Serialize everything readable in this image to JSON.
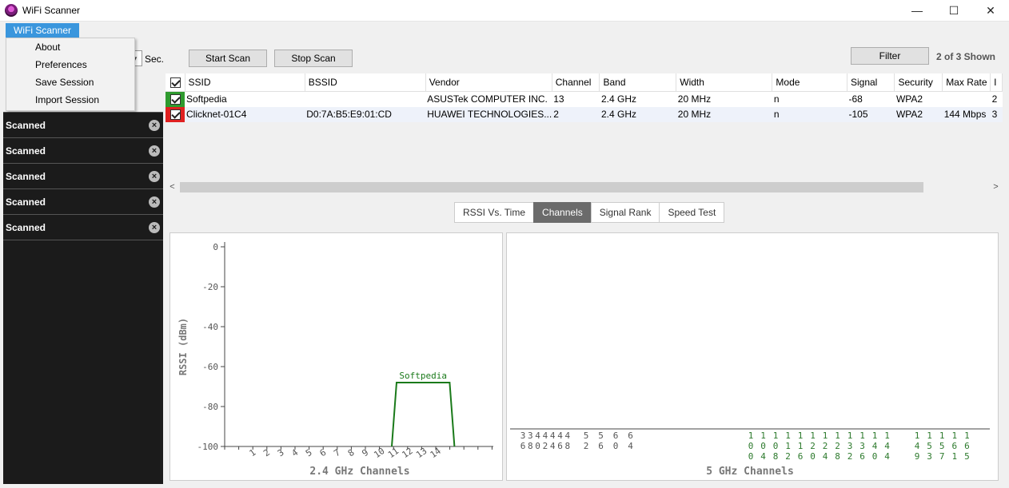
{
  "window": {
    "title": "WiFi Scanner",
    "minimize": "—",
    "maximize": "☐",
    "close": "✕"
  },
  "menu": {
    "top": "WiFi Scanner",
    "items": [
      "About",
      "Preferences",
      "Save Session",
      "Import Session"
    ]
  },
  "left": {
    "sec_label": "Sec.",
    "scans": [
      "Scanned",
      "Scanned",
      "Scanned",
      "Scanned",
      "Scanned"
    ]
  },
  "toolbar": {
    "start": "Start Scan",
    "stop": "Stop Scan",
    "filter": "Filter",
    "shown": "2 of 3 Shown"
  },
  "table": {
    "headers": [
      "SSID",
      "BSSID",
      "Vendor",
      "Channel",
      "Band",
      "Width",
      "Mode",
      "Signal",
      "Security",
      "Max Rate",
      "I"
    ],
    "rows": [
      {
        "color": "#2e9a2e",
        "cells": [
          "Softpedia",
          "",
          "ASUSTek COMPUTER INC.",
          "13",
          "2.4 GHz",
          "20 MHz",
          "n",
          "-68",
          "WPA2",
          "",
          "2"
        ]
      },
      {
        "color": "#e02020",
        "cells": [
          "Clicknet-01C4",
          "D0:7A:B5:E9:01:CD",
          "HUAWEI TECHNOLOGIES...",
          "2",
          "2.4 GHz",
          "20 MHz",
          "n",
          "-105",
          "WPA2",
          "144 Mbps",
          "3"
        ]
      }
    ]
  },
  "tabs": [
    "RSSI Vs. Time",
    "Channels",
    "Signal Rank",
    "Speed Test"
  ],
  "chart_data": [
    {
      "type": "area",
      "xlabel": "2.4 GHz Channels",
      "ylabel": "RSSI (dBm)",
      "ylim": [
        -100,
        0
      ],
      "yticks": [
        0,
        -20,
        -40,
        -60,
        -80,
        -100
      ],
      "xticks": [
        "1",
        "2",
        "3",
        "4",
        "5",
        "6",
        "7",
        "8",
        "9",
        "10",
        "11",
        "12",
        "13",
        "14"
      ],
      "series": [
        {
          "name": "Softpedia",
          "channel": 13,
          "rssi": -68,
          "width_mhz": 20,
          "color": "#1a7a1a"
        }
      ]
    },
    {
      "type": "area",
      "xlabel": "5 GHz Channels",
      "xticks": [
        "36",
        "38",
        "40",
        "42",
        "44",
        "46",
        "48",
        "52",
        "56",
        "60",
        "64",
        "100",
        "104",
        "108",
        "112",
        "116",
        "120",
        "124",
        "128",
        "132",
        "136",
        "140",
        "144",
        "149",
        "153",
        "157",
        "161",
        "165"
      ],
      "series": []
    }
  ]
}
